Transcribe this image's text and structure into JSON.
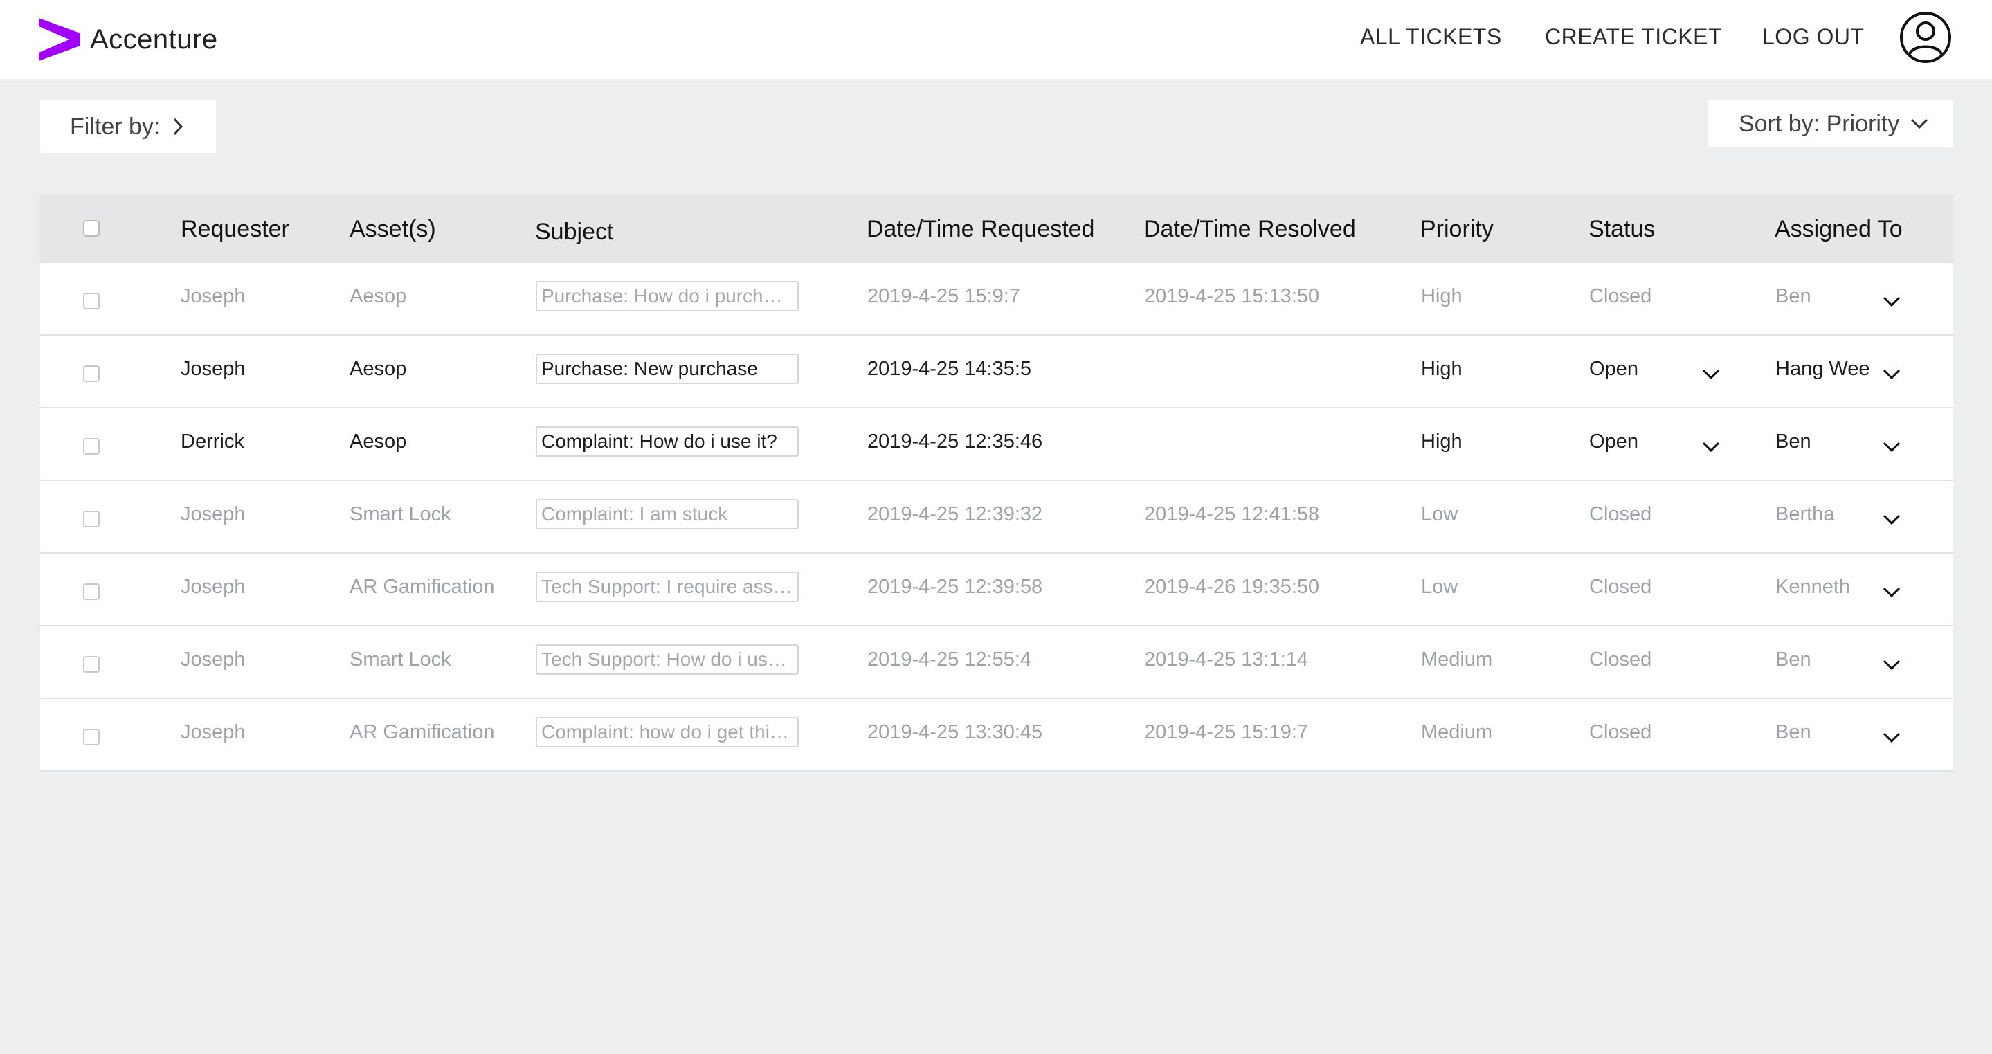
{
  "header": {
    "brand": "Accenture",
    "brand_color": "#a100ff",
    "nav": {
      "all_tickets": "ALL TICKETS",
      "create_ticket": "CREATE TICKET",
      "log_out": "LOG OUT"
    },
    "avatar_icon": "user-circle-icon"
  },
  "toolbar": {
    "filter_label": "Filter by:",
    "sort_label": "Sort by: Priority"
  },
  "table": {
    "columns": {
      "requester": "Requester",
      "assets": "Asset(s)",
      "subject": "Subject",
      "date_requested": "Date/Time Requested",
      "date_resolved": "Date/Time Resolved",
      "priority": "Priority",
      "status": "Status",
      "assigned_to": "Assigned To"
    },
    "rows": [
      {
        "requester": "Joseph",
        "asset": "Aesop",
        "subject": "Purchase: How do i purchas…",
        "date_requested": "2019-4-25 15:9:7",
        "date_resolved": "2019-4-25 15:13:50",
        "priority": "High",
        "status": "Closed",
        "assigned_to": "Ben"
      },
      {
        "requester": "Joseph",
        "asset": "Aesop",
        "subject": "Purchase: New purchase",
        "date_requested": "2019-4-25 14:35:5",
        "date_resolved": "",
        "priority": "High",
        "status": "Open",
        "assigned_to": "Hang Wee"
      },
      {
        "requester": "Derrick",
        "asset": "Aesop",
        "subject": "Complaint: How do i use it?",
        "date_requested": "2019-4-25 12:35:46",
        "date_resolved": "",
        "priority": "High",
        "status": "Open",
        "assigned_to": "Ben"
      },
      {
        "requester": "Joseph",
        "asset": "Smart Lock",
        "subject": "Complaint: I am stuck",
        "date_requested": "2019-4-25 12:39:32",
        "date_resolved": "2019-4-25 12:41:58",
        "priority": "Low",
        "status": "Closed",
        "assigned_to": "Bertha"
      },
      {
        "requester": "Joseph",
        "asset": "AR Gamification",
        "subject": "Tech Support: I require assis…",
        "date_requested": "2019-4-25 12:39:58",
        "date_resolved": "2019-4-26 19:35:50",
        "priority": "Low",
        "status": "Closed",
        "assigned_to": "Kenneth"
      },
      {
        "requester": "Joseph",
        "asset": "Smart Lock",
        "subject": "Tech Support: How do i use t…",
        "date_requested": "2019-4-25 12:55:4",
        "date_resolved": "2019-4-25 13:1:14",
        "priority": "Medium",
        "status": "Closed",
        "assigned_to": "Ben"
      },
      {
        "requester": "Joseph",
        "asset": "AR Gamification",
        "subject": "Complaint: how do i get this …",
        "date_requested": "2019-4-25 13:30:45",
        "date_resolved": "2019-4-25 15:19:7",
        "priority": "Medium",
        "status": "Closed",
        "assigned_to": "Ben"
      }
    ]
  }
}
